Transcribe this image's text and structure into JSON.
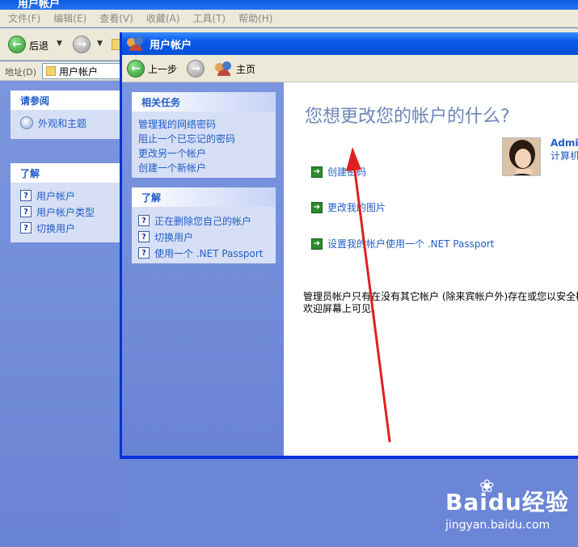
{
  "background_window": {
    "title": "用户帐户",
    "menu": [
      "文件(F)",
      "编辑(E)",
      "查看(V)",
      "收藏(A)",
      "工具(T)",
      "帮助(H)"
    ],
    "toolbar": {
      "back_label": "后退"
    },
    "address": {
      "label": "地址(D)",
      "value": "用户帐户"
    },
    "see_also": {
      "title": "请参阅",
      "items": [
        {
          "label": "外观和主题",
          "icon": "theme-icon"
        }
      ]
    },
    "learn_about": {
      "title": "了解",
      "items": [
        {
          "label": "用户帐户"
        },
        {
          "label": "用户帐户类型"
        },
        {
          "label": "切换用户"
        }
      ]
    }
  },
  "window": {
    "title": "用户帐户",
    "toolbar": {
      "back_label": "上一步",
      "home_label": "主页"
    },
    "related_tasks": {
      "title": "相关任务",
      "items": [
        "管理我的网络密码",
        "阻止一个已忘记的密码",
        "更改另一个帐户",
        "创建一个新帐户"
      ]
    },
    "learn_about": {
      "title": "了解",
      "items": [
        "正在删除您自己的帐户",
        "切换用户",
        "使用一个 .NET Passport"
      ]
    },
    "main": {
      "heading": "您想更改您的帐户的什么?",
      "options": [
        "创建密码",
        "更改我的图片",
        "设置我的帐户使用一个 .NET Passport"
      ],
      "user": {
        "name": "Admin",
        "type": "计算机"
      },
      "note_lines": [
        "管理员帐户只有在没有其它帐户 (除来宾帐户外)存在或您以安全模",
        "欢迎屏幕上可见。"
      ]
    }
  },
  "watermark": {
    "logo": "Baidu经验",
    "url": "jingyan.baidu.com"
  },
  "colors": {
    "link": "#215dc6",
    "titlebar": "#0a5ae8",
    "panel_bg": "#6b86d6",
    "arrow": "#e02020"
  }
}
